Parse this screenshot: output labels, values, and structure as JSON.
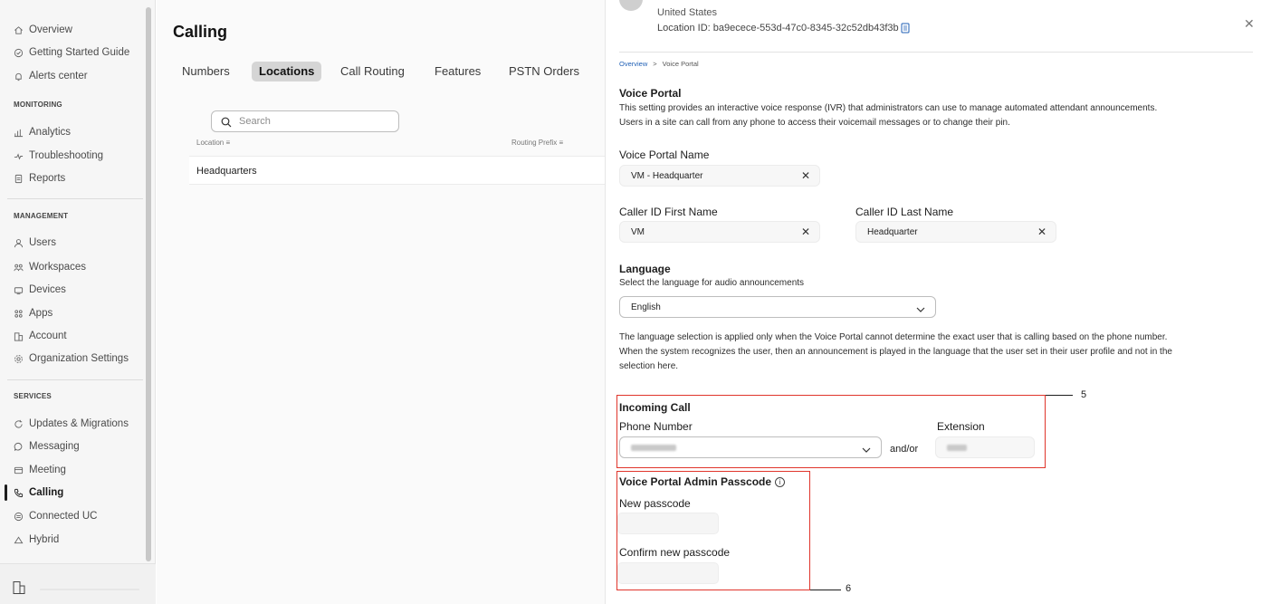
{
  "sidebar": {
    "top_items": [
      {
        "label": "Overview",
        "icon": "home-icon"
      },
      {
        "label": "Getting Started Guide",
        "icon": "check-circle-icon"
      },
      {
        "label": "Alerts center",
        "icon": "bell-icon"
      }
    ],
    "monitoring": {
      "label": "MONITORING",
      "items": [
        {
          "label": "Analytics",
          "icon": "bar-chart-icon"
        },
        {
          "label": "Troubleshooting",
          "icon": "pulse-icon"
        },
        {
          "label": "Reports",
          "icon": "report-icon"
        }
      ]
    },
    "management": {
      "label": "MANAGEMENT",
      "items": [
        {
          "label": "Users",
          "icon": "user-icon"
        },
        {
          "label": "Workspaces",
          "icon": "workspaces-icon"
        },
        {
          "label": "Devices",
          "icon": "device-icon"
        },
        {
          "label": "Apps",
          "icon": "apps-icon"
        },
        {
          "label": "Account",
          "icon": "account-icon"
        },
        {
          "label": "Organization Settings",
          "icon": "gear-icon"
        }
      ]
    },
    "services": {
      "label": "SERVICES",
      "items": [
        {
          "label": "Updates & Migrations",
          "icon": "refresh-icon"
        },
        {
          "label": "Messaging",
          "icon": "message-icon"
        },
        {
          "label": "Meeting",
          "icon": "meeting-icon"
        },
        {
          "label": "Calling",
          "icon": "phone-icon"
        },
        {
          "label": "Connected UC",
          "icon": "connected-uc-icon"
        },
        {
          "label": "Hybrid",
          "icon": "cloud-icon"
        }
      ]
    }
  },
  "main": {
    "title": "Calling",
    "tabs": [
      "Numbers",
      "Locations",
      "Call Routing",
      "Features",
      "PSTN Orders"
    ],
    "selected_tab": "Locations",
    "search_placeholder": "Search",
    "columns": [
      "Location",
      "Routing Prefix"
    ],
    "rows": [
      "Headquarters"
    ]
  },
  "panel": {
    "country": "United States",
    "location_id": "Location ID: ba9ecece-553d-47c0-8345-32c52db43f3b",
    "breadcrumb": {
      "first": "Overview",
      "separator": ">",
      "current": "Voice Portal"
    },
    "voice_portal": {
      "heading": "Voice Portal",
      "description_1": "This setting provides an interactive voice response (IVR) that administrators can use to manage automated attendant announcements.",
      "description_2": "Users in a site can call from any phone to access their voicemail messages or to change their pin."
    },
    "voice_portal_name": {
      "label": "Voice Portal Name",
      "value": "VM - Headquarter"
    },
    "caller_id_first": {
      "label": "Caller ID First Name",
      "value": "VM"
    },
    "caller_id_last": {
      "label": "Caller ID Last Name",
      "value": "Headquarter"
    },
    "language": {
      "heading": "Language",
      "subtext": "Select the language for audio announcements",
      "value": "English",
      "note_1": "The language selection is applied only when the Voice Portal cannot determine the exact user that is calling based on the phone number.",
      "note_2": "When the system recognizes the user, then an announcement is played in the language that the user set in their user profile and not in the",
      "note_3": "selection here."
    },
    "incoming_call": {
      "heading": "Incoming Call",
      "phone_label": "Phone Number",
      "and_or": "and/or",
      "extension_label": "Extension"
    },
    "admin_passcode": {
      "heading": "Voice Portal Admin Passcode",
      "new_label": "New passcode",
      "confirm_label": "Confirm new passcode"
    },
    "callouts": {
      "incoming": "5",
      "passcode": "6"
    },
    "accent_color": "#e0352b"
  }
}
